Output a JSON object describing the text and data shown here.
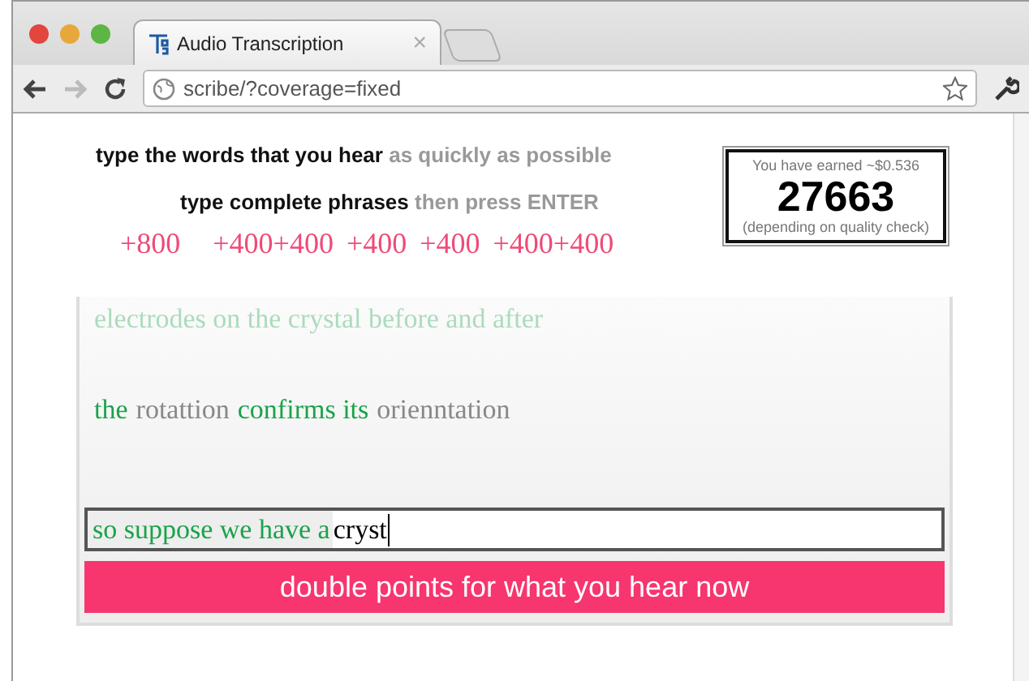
{
  "browser": {
    "tab_title": "Audio Transcription",
    "tab_close": "×",
    "url": "scribe/?coverage=fixed",
    "forward_disabled": true
  },
  "instructions": [
    {
      "parts": [
        {
          "text": "type the words that you hear",
          "kind": "strong"
        },
        {
          "text": "as quickly as possible",
          "kind": "hint"
        }
      ]
    },
    {
      "parts": [
        {
          "text": "type complete phrases",
          "kind": "strong"
        },
        {
          "text": "then press ENTER",
          "kind": "hint"
        }
      ]
    }
  ],
  "bonuses": [
    "+800",
    "+400+400",
    "+400",
    "+400",
    "+400+400"
  ],
  "earnings": {
    "earned": "You have earned ~$0.536",
    "score": "27663",
    "note": "(depending on quality check)"
  },
  "transcript": {
    "lines": [
      {
        "faded": true,
        "words": [
          {
            "text": "electrodes on the crystal before and after",
            "correct": true
          }
        ]
      },
      {
        "faded": false,
        "words": [
          {
            "text": "the",
            "correct": true
          },
          {
            "text": "rotattion",
            "correct": false
          },
          {
            "text": "confirms its",
            "correct": true
          },
          {
            "text": "orienntation",
            "correct": false
          }
        ]
      }
    ],
    "input": {
      "committed": "so suppose we have a",
      "value": "cryst"
    },
    "banner": "double points for what you hear now"
  }
}
